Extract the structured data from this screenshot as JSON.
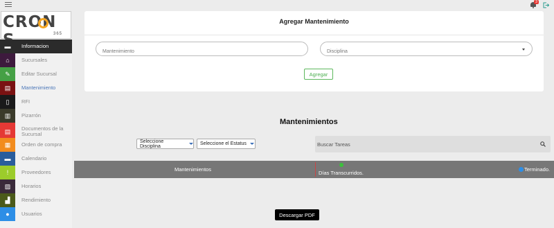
{
  "topbar": {
    "notification_count": "3"
  },
  "logo": {
    "text": "CRON S",
    "sub": "365"
  },
  "sidebar": {
    "items": [
      {
        "label": "Informacion",
        "icon": "inbox-icon",
        "color": "#2b2b2b"
      },
      {
        "label": "Sucursales",
        "icon": "home-icon",
        "color": "#3d1a3d"
      },
      {
        "label": "Editar Sucursal",
        "icon": "pencil-icon",
        "color": "#45a045"
      },
      {
        "label": "Mantenimiento",
        "icon": "document-icon",
        "color": "#7a1212"
      },
      {
        "label": "RFI",
        "icon": "clipboard-icon",
        "color": "#1a1a1a"
      },
      {
        "label": "Pizarrón",
        "icon": "board-icon",
        "color": "#3a3a2a"
      },
      {
        "label": "Documentos de la Sucursal",
        "icon": "file-icon",
        "color": "#e53935"
      },
      {
        "label": "Orden de compra",
        "icon": "archive-icon",
        "color": "#f28c1e"
      },
      {
        "label": "Calendario",
        "icon": "calendar-icon",
        "color": "#2a5d9c"
      },
      {
        "label": "Proveedores",
        "icon": "flashlight-icon",
        "color": "#9ccc2b"
      },
      {
        "label": "Horarios",
        "icon": "chart-icon",
        "color": "#3a2a3a"
      },
      {
        "label": "Rendimiento",
        "icon": "bars-icon",
        "color": "#4b5a1a"
      },
      {
        "label": "Usuarios",
        "icon": "user-icon",
        "color": "#2d8ee6"
      }
    ]
  },
  "add_card": {
    "title": "Agregar Mantenimiento",
    "mantenimiento_placeholder": "Mantenimiento",
    "disciplina_placeholder": "Disciplina",
    "agregar_label": "Agregar"
  },
  "list": {
    "title": "Mantenimientos",
    "disciplina_select": "Seleccione Disciplina",
    "estatus_select": "Seleccione el Estatus",
    "search_placeholder": "Buscar Tareas",
    "col_mantenimientos": "Mantenimientos",
    "col_dias": "Días Transcurridos.",
    "col_terminado": "Terminado."
  },
  "download_label": "Descargar PDF",
  "colors": {
    "accent_green": "#4caf50",
    "status_green": "#3cc03c",
    "status_blue": "#2d8ee6",
    "badge_red": "#e53935"
  }
}
